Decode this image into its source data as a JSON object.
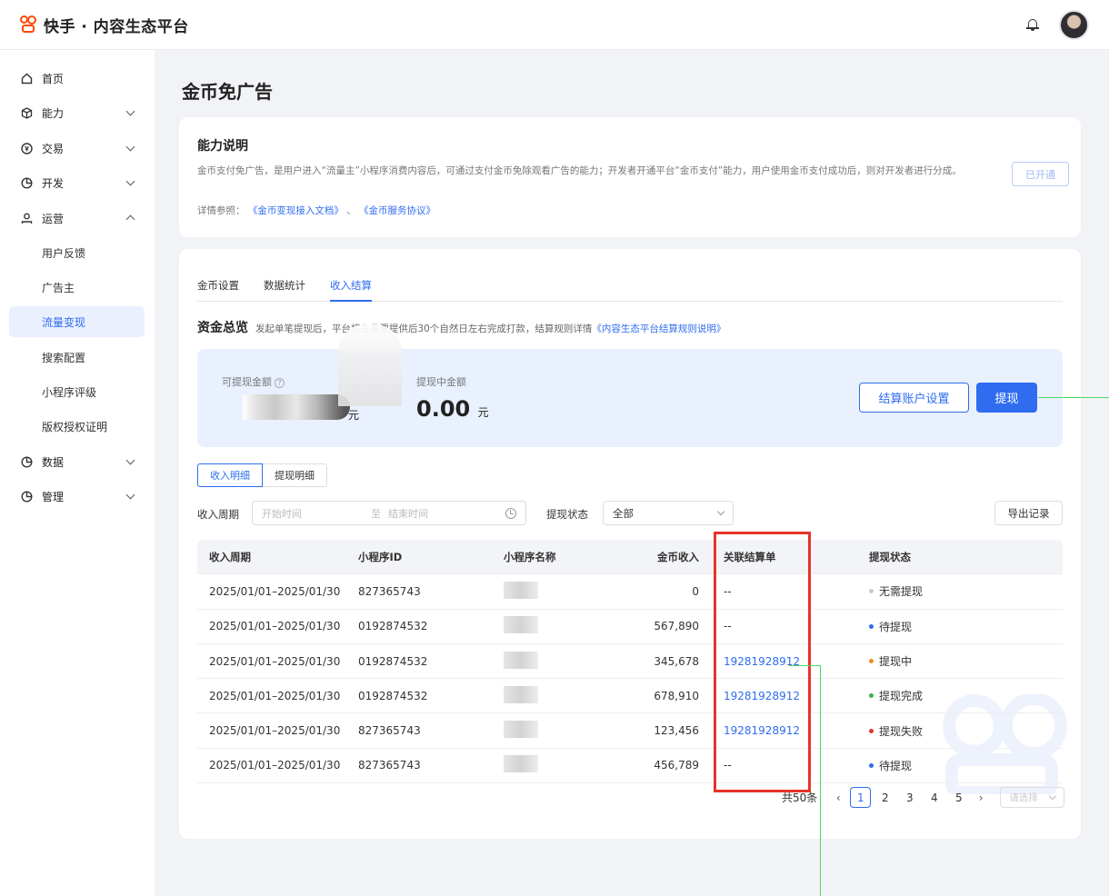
{
  "app": {
    "title": "快手 · 内容生态平台"
  },
  "sidebar": {
    "items": [
      {
        "label": "首页",
        "icon": "home-icon"
      },
      {
        "label": "能力",
        "icon": "cube-icon",
        "chevron": "down"
      },
      {
        "label": "交易",
        "icon": "currency-icon",
        "chevron": "down"
      },
      {
        "label": "开发",
        "icon": "pie-icon",
        "chevron": "down"
      },
      {
        "label": "运营",
        "icon": "user-icon",
        "chevron": "up"
      },
      {
        "label": "用户反馈"
      },
      {
        "label": "广告主"
      },
      {
        "label": "流量变现",
        "active": true
      },
      {
        "label": "搜索配置"
      },
      {
        "label": "小程序评级"
      },
      {
        "label": "版权授权证明"
      },
      {
        "label": "数据",
        "icon": "pie-icon",
        "chevron": "down"
      },
      {
        "label": "管理",
        "icon": "pie-icon",
        "chevron": "down"
      }
    ]
  },
  "page": {
    "title": "金币免广告"
  },
  "capability": {
    "title": "能力说明",
    "desc": "金币支付免广告，是用户进入“流量主”小程序消费内容后，可通过支付金币免除观看广告的能力；开发者开通平台“金币支付”能力，用户使用金币支付成功后，则对开发者进行分成。",
    "ref_prefix": "详情参照：",
    "ref_link1": "《金币变现接入文档》",
    "ref_sep": "、",
    "ref_link2": "《金币服务协议》",
    "status_button": "已开通"
  },
  "tabs": [
    "金币设置",
    "数据统计",
    "收入结算"
  ],
  "active_tab": "收入结算",
  "funds": {
    "title": "资金总览",
    "desc": "发起单笔提现后，平台将在发票提供后30个自然日左右完成打款，结算规则详情",
    "desc_link": "《内容生态平台结算规则说明》",
    "available_label": "可提现金额",
    "available_unit": "元",
    "pending_label": "提现中金额",
    "pending_amount": "0.00",
    "pending_unit": "元",
    "account_button": "结算账户设置",
    "withdraw_button": "提现"
  },
  "segments": {
    "income": "收入明细",
    "withdraw": "提现明细"
  },
  "filters": {
    "period_label": "收入周期",
    "start_placeholder": "开始时间",
    "to": "至",
    "end_placeholder": "结束时间",
    "status_label": "提现状态",
    "status_value": "全部",
    "export_button": "导出记录"
  },
  "table": {
    "headers": [
      "收入周期",
      "小程序ID",
      "小程序名称",
      "金币收入",
      "关联结算单",
      "提现状态"
    ],
    "rows": [
      {
        "period": "2025/01/01–2025/01/30",
        "id": "827365743",
        "coin": "0",
        "order": "--",
        "status": "无需提现",
        "color": "#cccccc",
        "link": false
      },
      {
        "period": "2025/01/01–2025/01/30",
        "id": "0192874532",
        "coin": "567,890",
        "order": "--",
        "status": "待提现",
        "color": "#2f6cf0",
        "link": false
      },
      {
        "period": "2025/01/01–2025/01/30",
        "id": "0192874532",
        "coin": "345,678",
        "order": "19281928912",
        "status": "提现中",
        "color": "#f08a24",
        "link": true
      },
      {
        "period": "2025/01/01–2025/01/30",
        "id": "0192874532",
        "coin": "678,910",
        "order": "19281928912",
        "status": "提现完成",
        "color": "#3bb54a",
        "link": true
      },
      {
        "period": "2025/01/01–2025/01/30",
        "id": "827365743",
        "coin": "123,456",
        "order": "19281928912",
        "status": "提现失败",
        "color": "#e8332a",
        "link": true
      },
      {
        "period": "2025/01/01–2025/01/30",
        "id": "827365743",
        "coin": "456,789",
        "order": "--",
        "status": "待提现",
        "color": "#2f6cf0",
        "link": false
      }
    ]
  },
  "pagination": {
    "total": "共50条",
    "pages": [
      "1",
      "2",
      "3",
      "4",
      "5"
    ],
    "current": "1",
    "size_placeholder": "请选择"
  }
}
